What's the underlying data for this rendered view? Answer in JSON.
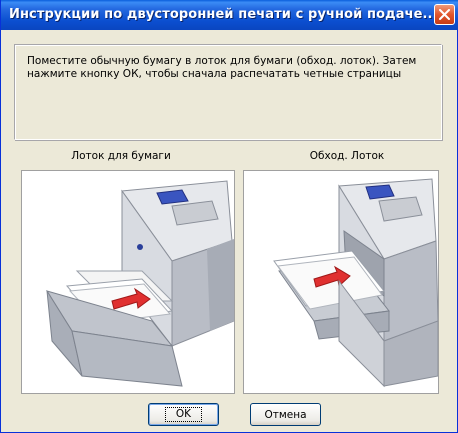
{
  "window": {
    "title": "Инструкции по двусторонней печати с ручной подаче..."
  },
  "message": {
    "line1": "Поместите обычную бумагу в лоток для бумаги (обход. лоток). Затем",
    "line2": "нажмите кнопку ОК, чтобы сначала распечатать четные страницы"
  },
  "images": {
    "left_caption": "Лоток для бумаги",
    "right_caption": "Обход. Лоток"
  },
  "buttons": {
    "ok_label": "OK",
    "cancel_label": "Отмена"
  },
  "icons": {
    "close": "close-icon",
    "arrow_color": "#e03030"
  }
}
